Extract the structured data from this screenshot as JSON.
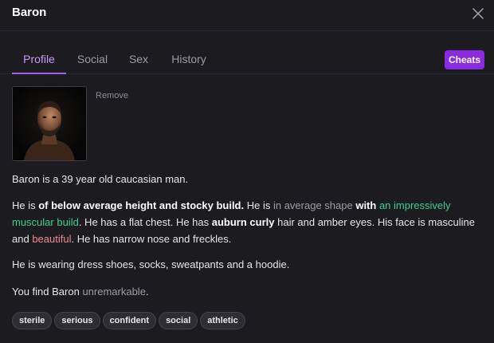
{
  "window": {
    "title": "Baron"
  },
  "tabs": [
    {
      "label": "Profile",
      "active": true
    },
    {
      "label": "Social",
      "active": false
    },
    {
      "label": "Sex",
      "active": false
    },
    {
      "label": "History",
      "active": false
    }
  ],
  "cheats_label": "Cheats",
  "portrait": {
    "remove_label": "Remove"
  },
  "description": {
    "intro": "Baron is a 39 year old caucasian man.",
    "p2": {
      "s1": "He is ",
      "s2": "of below average height and stocky build.",
      "s3": " He is ",
      "s4": "in average shape",
      "s5": " with ",
      "s6": "an impressively muscular build",
      "s7": ". He has a flat chest. He has ",
      "s8": "auburn curly",
      "s9": " hair and amber eyes. His face is masculine and ",
      "s10": "beautiful",
      "s11": ". He has narrow nose and freckles."
    },
    "clothing": "He is wearing dress shoes, socks, sweatpants and a hoodie.",
    "opinion": {
      "s1": "You find Baron ",
      "s2": "unremarkable",
      "s3": "."
    }
  },
  "tags": [
    "sterile",
    "serious",
    "confident",
    "social",
    "athletic"
  ],
  "colors": {
    "accent": "#8a2be2",
    "tab_active": "#c69cf5",
    "positive": "#3ecf8e",
    "beauty": "#f08b96",
    "background": "#1c1b20"
  },
  "icons": {
    "close": "close-icon",
    "portrait": "portrait-image"
  }
}
